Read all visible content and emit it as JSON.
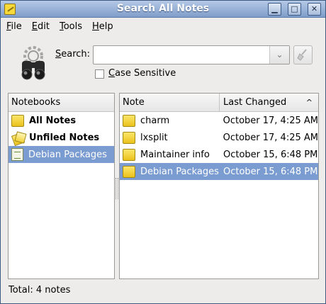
{
  "window": {
    "title": "Search All Notes",
    "controls": {
      "minimize": "▁",
      "maximize": "□",
      "close": "✕"
    }
  },
  "menu": [
    {
      "label": "File",
      "mnemonic": "F",
      "rest": "ile"
    },
    {
      "label": "Edit",
      "mnemonic": "E",
      "rest": "dit"
    },
    {
      "label": "Tools",
      "mnemonic": "T",
      "rest": "ools"
    },
    {
      "label": "Help",
      "mnemonic": "H",
      "rest": "elp"
    }
  ],
  "search": {
    "label_mnemonic": "S",
    "label_rest": "earch:",
    "value": "",
    "placeholder": "",
    "dropdown_arrow": "⌄",
    "case_sensitive": {
      "label_mnemonic": "C",
      "label_rest": "ase Sensitive",
      "checked": false
    }
  },
  "notebooks": {
    "header": "Notebooks",
    "items": [
      {
        "label": "All Notes",
        "icon": "folder-icon",
        "bold": true,
        "selected": false
      },
      {
        "label": "Unfiled Notes",
        "icon": "unfiled-notes-icon",
        "bold": true,
        "selected": false
      },
      {
        "label": "Debian Packages",
        "icon": "notebook-icon",
        "bold": false,
        "selected": true
      }
    ]
  },
  "notes": {
    "columns": {
      "note": "Note",
      "last_changed": "Last Changed",
      "sort_indicator": "^"
    },
    "rows": [
      {
        "title": "charm",
        "changed": "October 17, 4:25 AM",
        "selected": false
      },
      {
        "title": "lxsplit",
        "changed": "October 17, 4:25 AM",
        "selected": false
      },
      {
        "title": "Maintainer info",
        "changed": "October 15, 6:48 PM",
        "selected": false
      },
      {
        "title": "Debian Packages",
        "changed": "October 15, 6:48 PM",
        "selected": true
      }
    ]
  },
  "status": {
    "text": "Total: 4 notes"
  },
  "colors": {
    "selection": "#7a9cd1",
    "titlebar_top": "#b5c9e6",
    "titlebar_bottom": "#7f9dc9",
    "note_icon": "#f5d53a"
  }
}
